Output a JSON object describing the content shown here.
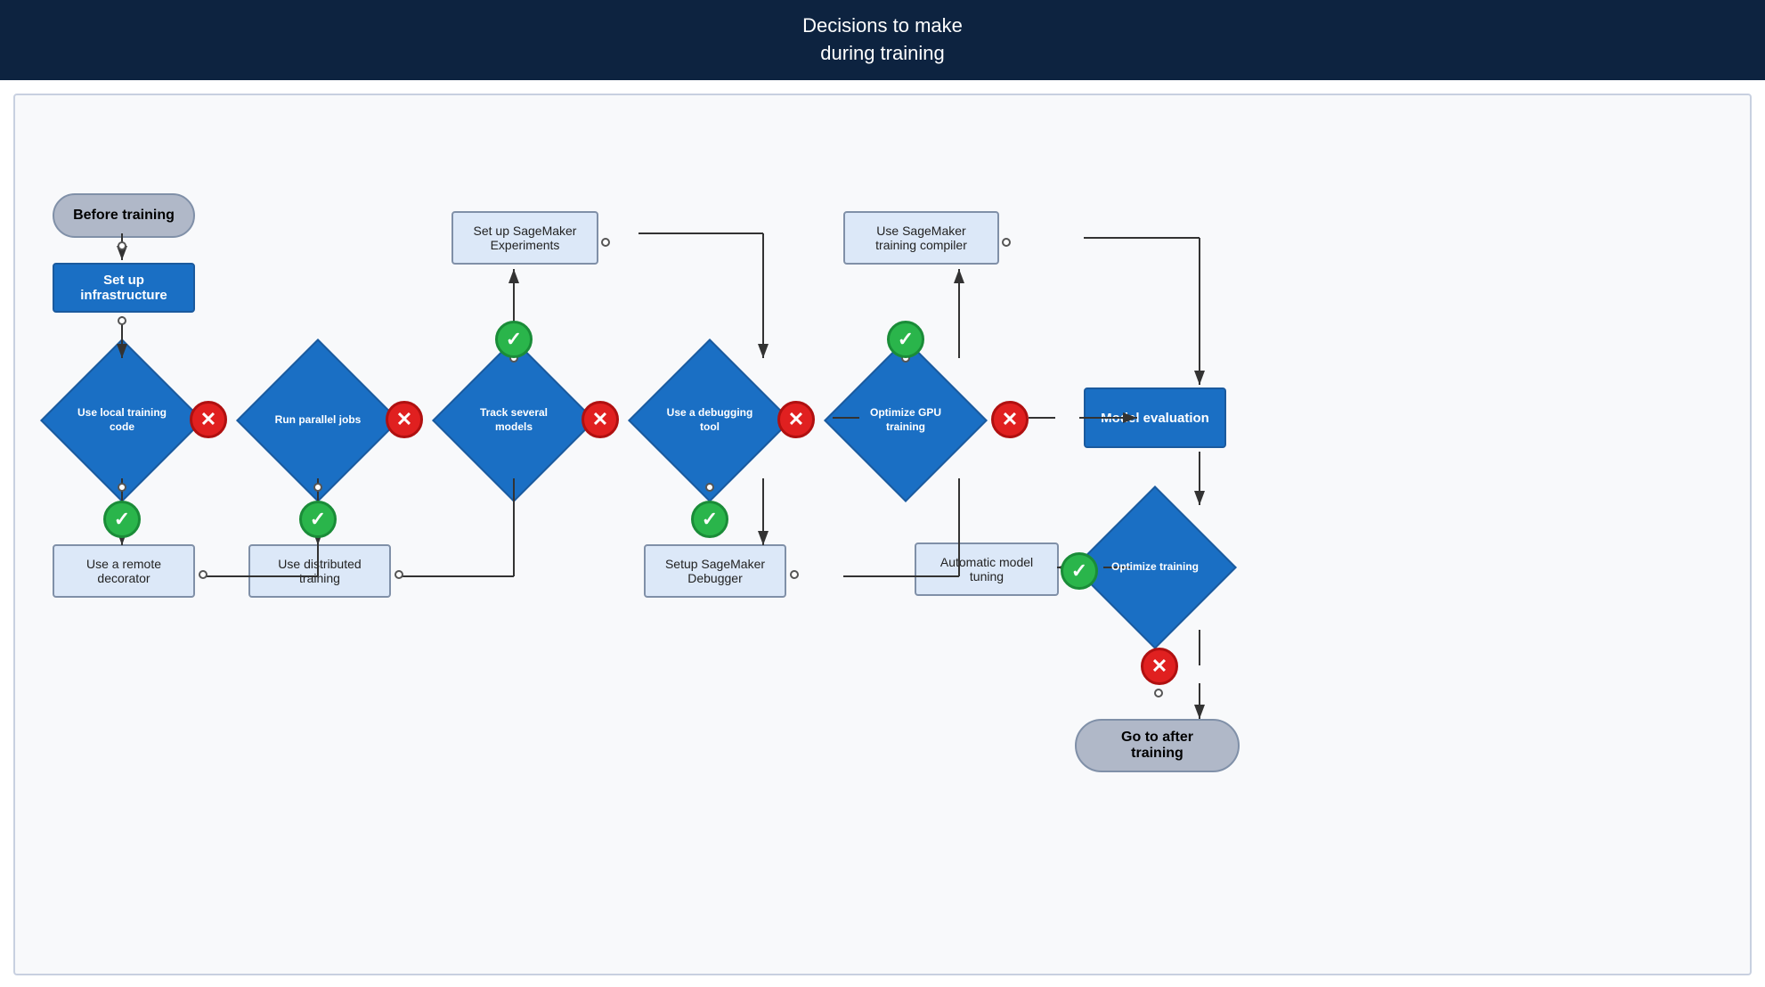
{
  "header": {
    "line1": "Decisions to make",
    "line2": "during training"
  },
  "nodes": {
    "before_training": "Before training",
    "set_up_infrastructure": "Set up infrastructure",
    "use_local_training_code": "Use local\ntraining code",
    "use_remote_decorator": "Use a remote\ndecorator",
    "run_parallel_jobs": "Run parallel\njobs",
    "use_distributed_training": "Use distributed\ntraining",
    "track_several_models": "Track several\nmodels",
    "set_up_sagemaker_experiments": "Set up SageMaker\nExperiments",
    "use_debugging_tool": "Use a\ndebugging\ntool",
    "setup_sagemaker_debugger": "Setup SageMaker\nDebugger",
    "optimize_gpu_training": "Optimize GPU\ntraining",
    "use_sagemaker_training_compiler": "Use SageMaker\ntraining compiler",
    "model_evaluation": "Model evaluation",
    "optimize_training": "Optimize\ntraining",
    "automatic_model_tuning": "Automatic model\ntuning",
    "go_to_after_training": "Go to after\ntraining"
  }
}
